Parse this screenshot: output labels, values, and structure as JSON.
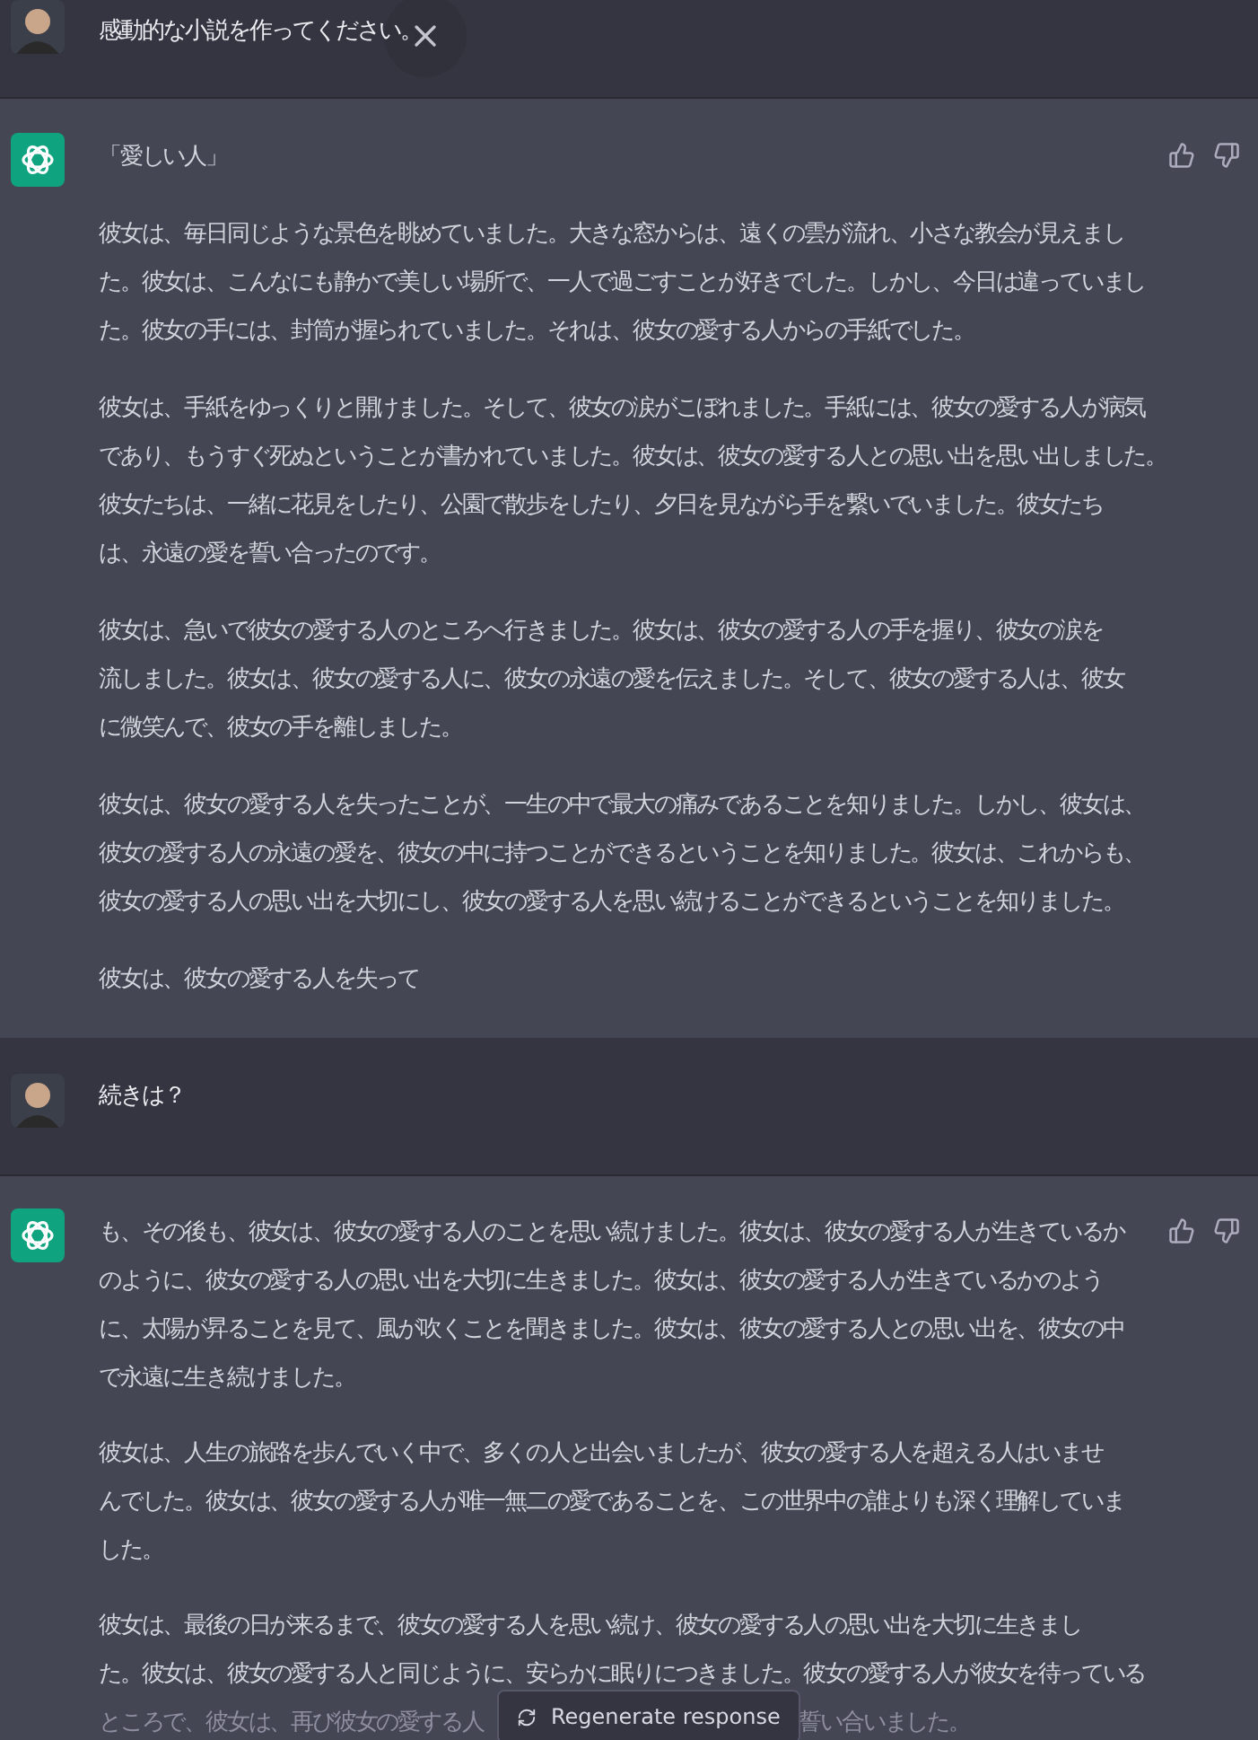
{
  "messages": [
    {
      "kind": "user",
      "text": "感動的な小説を作ってください。"
    },
    {
      "kind": "assistant",
      "feedback_buttons": true,
      "paragraphs": [
        [
          "「愛しい人」"
        ],
        [
          "彼女は、毎日同じような景色を眺めていました。大きな窓からは、遠くの雲が流れ、小さな教会が見えまし",
          "た。彼女は、こんなにも静かで美しい場所で、一人で過ごすことが好きでした。しかし、今日は違っていまし",
          "た。彼女の手には、封筒が握られていました。それは、彼女の愛する人からの手紙でした。"
        ],
        [
          "彼女は、手紙をゆっくりと開けました。そして、彼女の涙がこぼれました。手紙には、彼女の愛する人が病気",
          "であり、もうすぐ死ぬということが書かれていました。彼女は、彼女の愛する人との思い出を思い出しました。",
          "彼女たちは、一緒に花見をしたり、公園で散歩をしたり、夕日を見ながら手を繋いでいました。彼女たち",
          "は、永遠の愛を誓い合ったのです。"
        ],
        [
          "彼女は、急いで彼女の愛する人のところへ行きました。彼女は、彼女の愛する人の手を握り、彼女の涙を",
          "流しました。彼女は、彼女の愛する人に、彼女の永遠の愛を伝えました。そして、彼女の愛する人は、彼女",
          "に微笑んで、彼女の手を離しました。"
        ],
        [
          "彼女は、彼女の愛する人を失ったことが、一生の中で最大の痛みであることを知りました。しかし、彼女は、",
          "彼女の愛する人の永遠の愛を、彼女の中に持つことができるということを知りました。彼女は、これからも、",
          "彼女の愛する人の思い出を大切にし、彼女の愛する人を思い続けることができるということを知りました。"
        ],
        [
          "彼女は、彼女の愛する人を失って"
        ]
      ]
    },
    {
      "kind": "user",
      "text": "続きは？"
    },
    {
      "kind": "assistant",
      "feedback_buttons": true,
      "paragraphs": [
        [
          "も、その後も、彼女は、彼女の愛する人のことを思い続けました。彼女は、彼女の愛する人が生きているか",
          "のように、彼女の愛する人の思い出を大切に生きました。彼女は、彼女の愛する人が生きているかのよう",
          "に、太陽が昇ることを見て、風が吹くことを聞きました。彼女は、彼女の愛する人との思い出を、彼女の中",
          "で永遠に生き続けました。"
        ],
        [
          "彼女は、人生の旅路を歩んでいく中で、多くの人と出会いましたが、彼女の愛する人を超える人はいませ",
          "んでした。彼女は、彼女の愛する人が唯一無二の愛であることを、この世界中の誰よりも深く理解していま",
          "した。"
        ],
        [
          "彼女は、最後の日が来るまで、彼女の愛する人を思い続け、彼女の愛する人の思い出を大切に生きまし",
          "た。彼女は、彼女の愛する人と同じように、安らかに眠りにつきました。彼女の愛する人が彼女を待っている"
        ]
      ],
      "faded_line": {
        "before_overlay": "ところで、彼女は、再び彼女の愛する人",
        "after_overlay": "誓い合いました。"
      }
    }
  ],
  "regenerate_button": {
    "label": "Regenerate response"
  }
}
